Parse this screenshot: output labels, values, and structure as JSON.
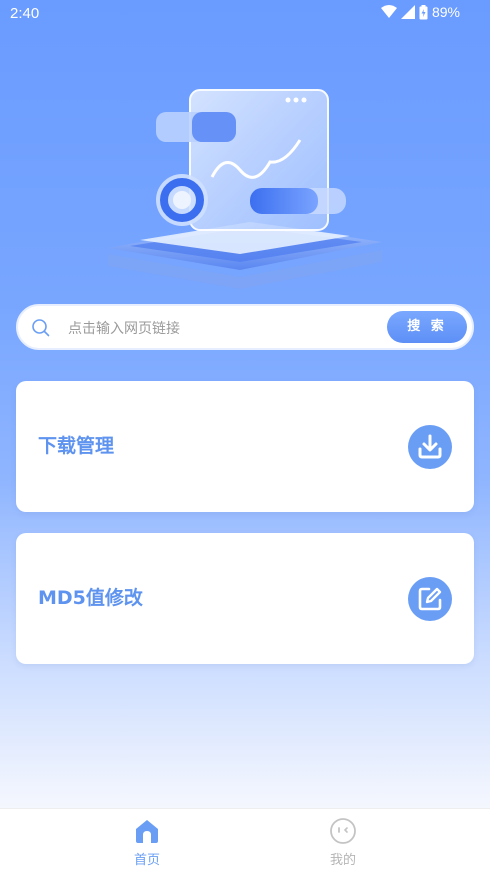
{
  "status_bar": {
    "time": "2:40",
    "battery_percent": "89%",
    "icons": [
      "wifi-icon",
      "cell-signal-icon",
      "battery-icon"
    ]
  },
  "search": {
    "placeholder": "点击输入网页链接",
    "value": "",
    "button_label": "搜 索"
  },
  "cards": [
    {
      "title": "下载管理",
      "icon": "download-icon"
    },
    {
      "title": "MD5值修改",
      "icon": "edit-icon"
    }
  ],
  "bottom_nav": {
    "items": [
      {
        "label": "首页",
        "icon": "home-icon",
        "active": true
      },
      {
        "label": "我的",
        "icon": "profile-face-icon",
        "active": false
      }
    ]
  },
  "colors": {
    "accent": "#6a9ef5",
    "title_text": "#5e93ef",
    "inactive_nav": "#b5b5b5",
    "background_top": "#6a9bff",
    "background_bottom": "#ffffff"
  }
}
